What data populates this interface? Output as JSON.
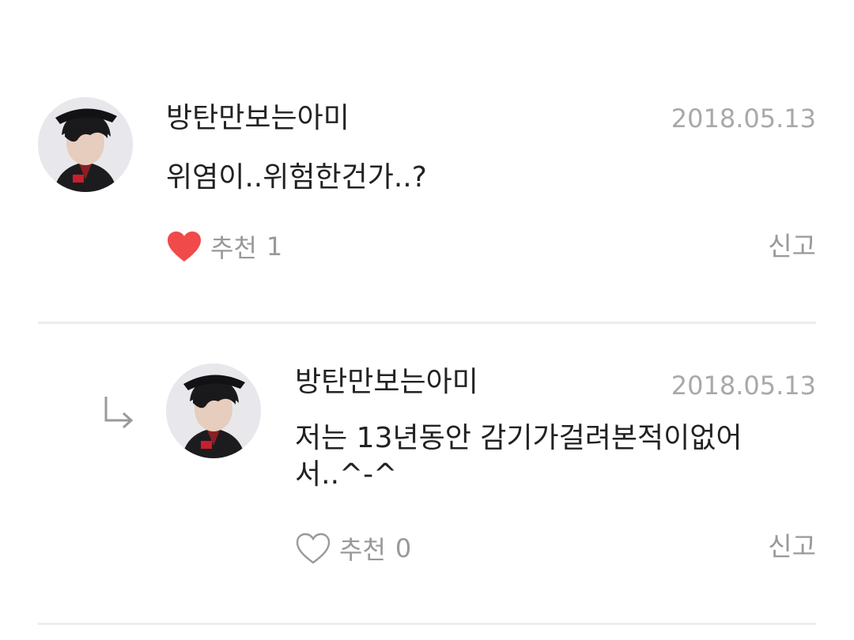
{
  "comments": [
    {
      "username": "방탄만보는아미",
      "date": "2018.05.13",
      "text": "위염이..위험한건가..?",
      "like_label": "추천",
      "like_count": "1",
      "liked": true,
      "report_label": "신고"
    }
  ],
  "replies": [
    {
      "username": "방탄만보는아미",
      "date": "2018.05.13",
      "text": "저는 13년동안 감기가걸려본적이없어\n서..^-^",
      "like_label": "추천",
      "like_count": "0",
      "liked": false,
      "report_label": "신고"
    }
  ],
  "colors": {
    "heart_active": "#f04a4a",
    "muted_text": "#999999",
    "date_text": "#a9a9a9",
    "divider": "#ececef"
  },
  "icons": {
    "like": "heart-icon",
    "reply": "reply-arrow-icon"
  }
}
